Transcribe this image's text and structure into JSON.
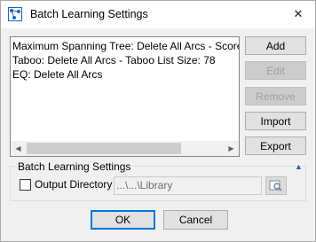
{
  "window": {
    "title": "Batch Learning Settings",
    "close_glyph": "✕",
    "app_icon": "bayesian-network-icon"
  },
  "list": {
    "items": [
      "Maximum Spanning Tree: Delete All Arcs - Score Type: BDe",
      "Taboo: Delete All Arcs - Taboo List Size: 78",
      "EQ: Delete All Arcs"
    ]
  },
  "buttons": {
    "add": "Add",
    "edit": "Edit",
    "remove": "Remove",
    "import": "Import",
    "export": "Export",
    "ok": "OK",
    "cancel": "Cancel"
  },
  "group": {
    "title": "Batch Learning Settings",
    "collapse_glyph": "▲",
    "output_directory_label": "Output Directory",
    "output_directory_checked": false,
    "path_value": "...\\...\\Library",
    "browse_icon": "browse-folder-icon"
  },
  "colors": {
    "focus_border": "#0078d7",
    "dialog_bg": "#f0f0f0"
  }
}
